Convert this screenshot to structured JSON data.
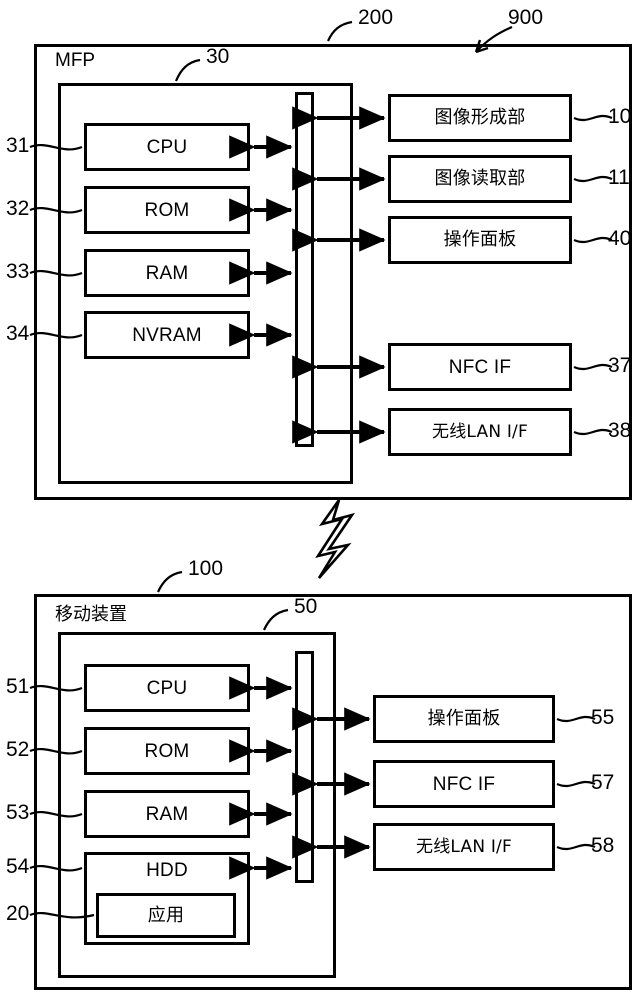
{
  "figure": {
    "system_ref": "900",
    "mfp": {
      "outer_ref": "200",
      "outer_label": "MFP",
      "inner_ref": "30",
      "left_units": [
        {
          "ref": "31",
          "label": "CPU"
        },
        {
          "ref": "32",
          "label": "ROM"
        },
        {
          "ref": "33",
          "label": "RAM"
        },
        {
          "ref": "34",
          "label": "NVRAM"
        }
      ],
      "right_units": [
        {
          "ref": "10",
          "label": "图像形成部"
        },
        {
          "ref": "11",
          "label": "图像读取部"
        },
        {
          "ref": "40",
          "label": "操作面板"
        },
        {
          "ref": "37",
          "label": "NFC IF"
        },
        {
          "ref": "38",
          "label": "无线LAN I/F"
        }
      ]
    },
    "mobile": {
      "outer_ref": "100",
      "outer_label": "移动装置",
      "inner_ref": "50",
      "left_units": [
        {
          "ref": "51",
          "label": "CPU"
        },
        {
          "ref": "52",
          "label": "ROM"
        },
        {
          "ref": "53",
          "label": "RAM"
        },
        {
          "ref": "54",
          "label": "HDD"
        }
      ],
      "nested_unit": {
        "ref": "20",
        "label": "应用"
      },
      "right_units": [
        {
          "ref": "55",
          "label": "操作面板"
        },
        {
          "ref": "57",
          "label": "NFC IF"
        },
        {
          "ref": "58",
          "label": "无线LAN I/F"
        }
      ]
    },
    "link": {
      "icon": "lightning-bolt-icon"
    }
  }
}
